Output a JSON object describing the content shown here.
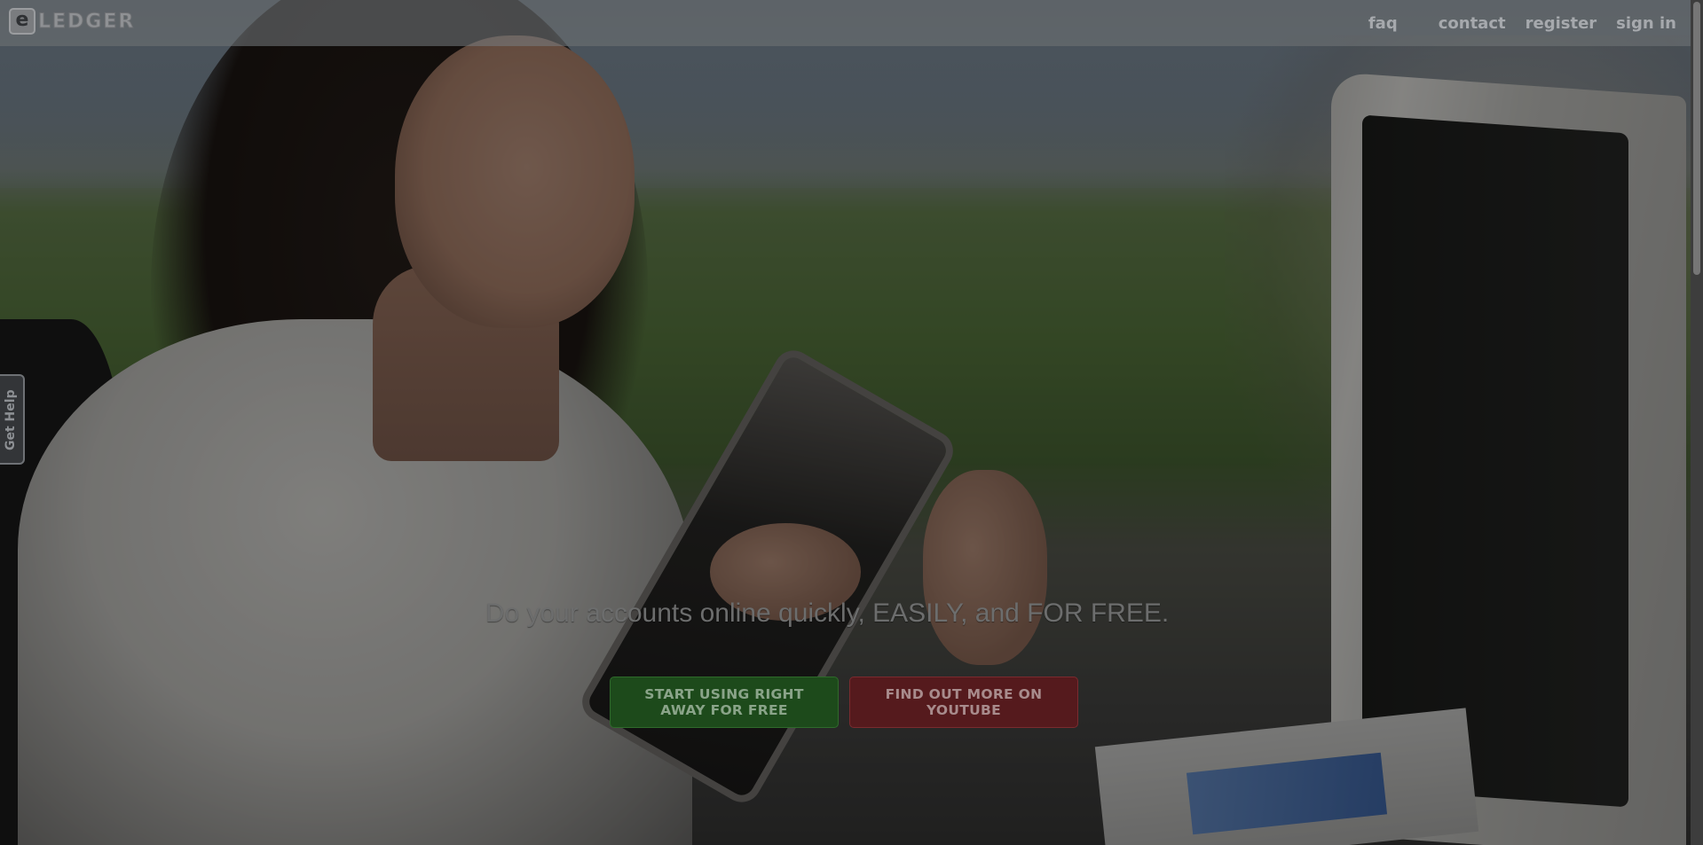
{
  "brand": {
    "logo_letter": "e",
    "logo_word": "LEDGER"
  },
  "nav": {
    "items": [
      "faq",
      "contact",
      "register",
      "sign in"
    ]
  },
  "help_tab": {
    "label": "Get Help"
  },
  "hero": {
    "tagline": "Do your accounts online quickly, EASILY, and FOR FREE.",
    "primary_button": "START USING RIGHT AWAY FOR FREE",
    "secondary_button": "FIND OUT MORE ON YOUTUBE"
  },
  "colors": {
    "primary_button": "#1d4a1b",
    "secondary_button": "#551a1d",
    "overlay": "rgba(0,0,0,0.45)"
  },
  "icons": {
    "scroll": "scrollbar"
  }
}
